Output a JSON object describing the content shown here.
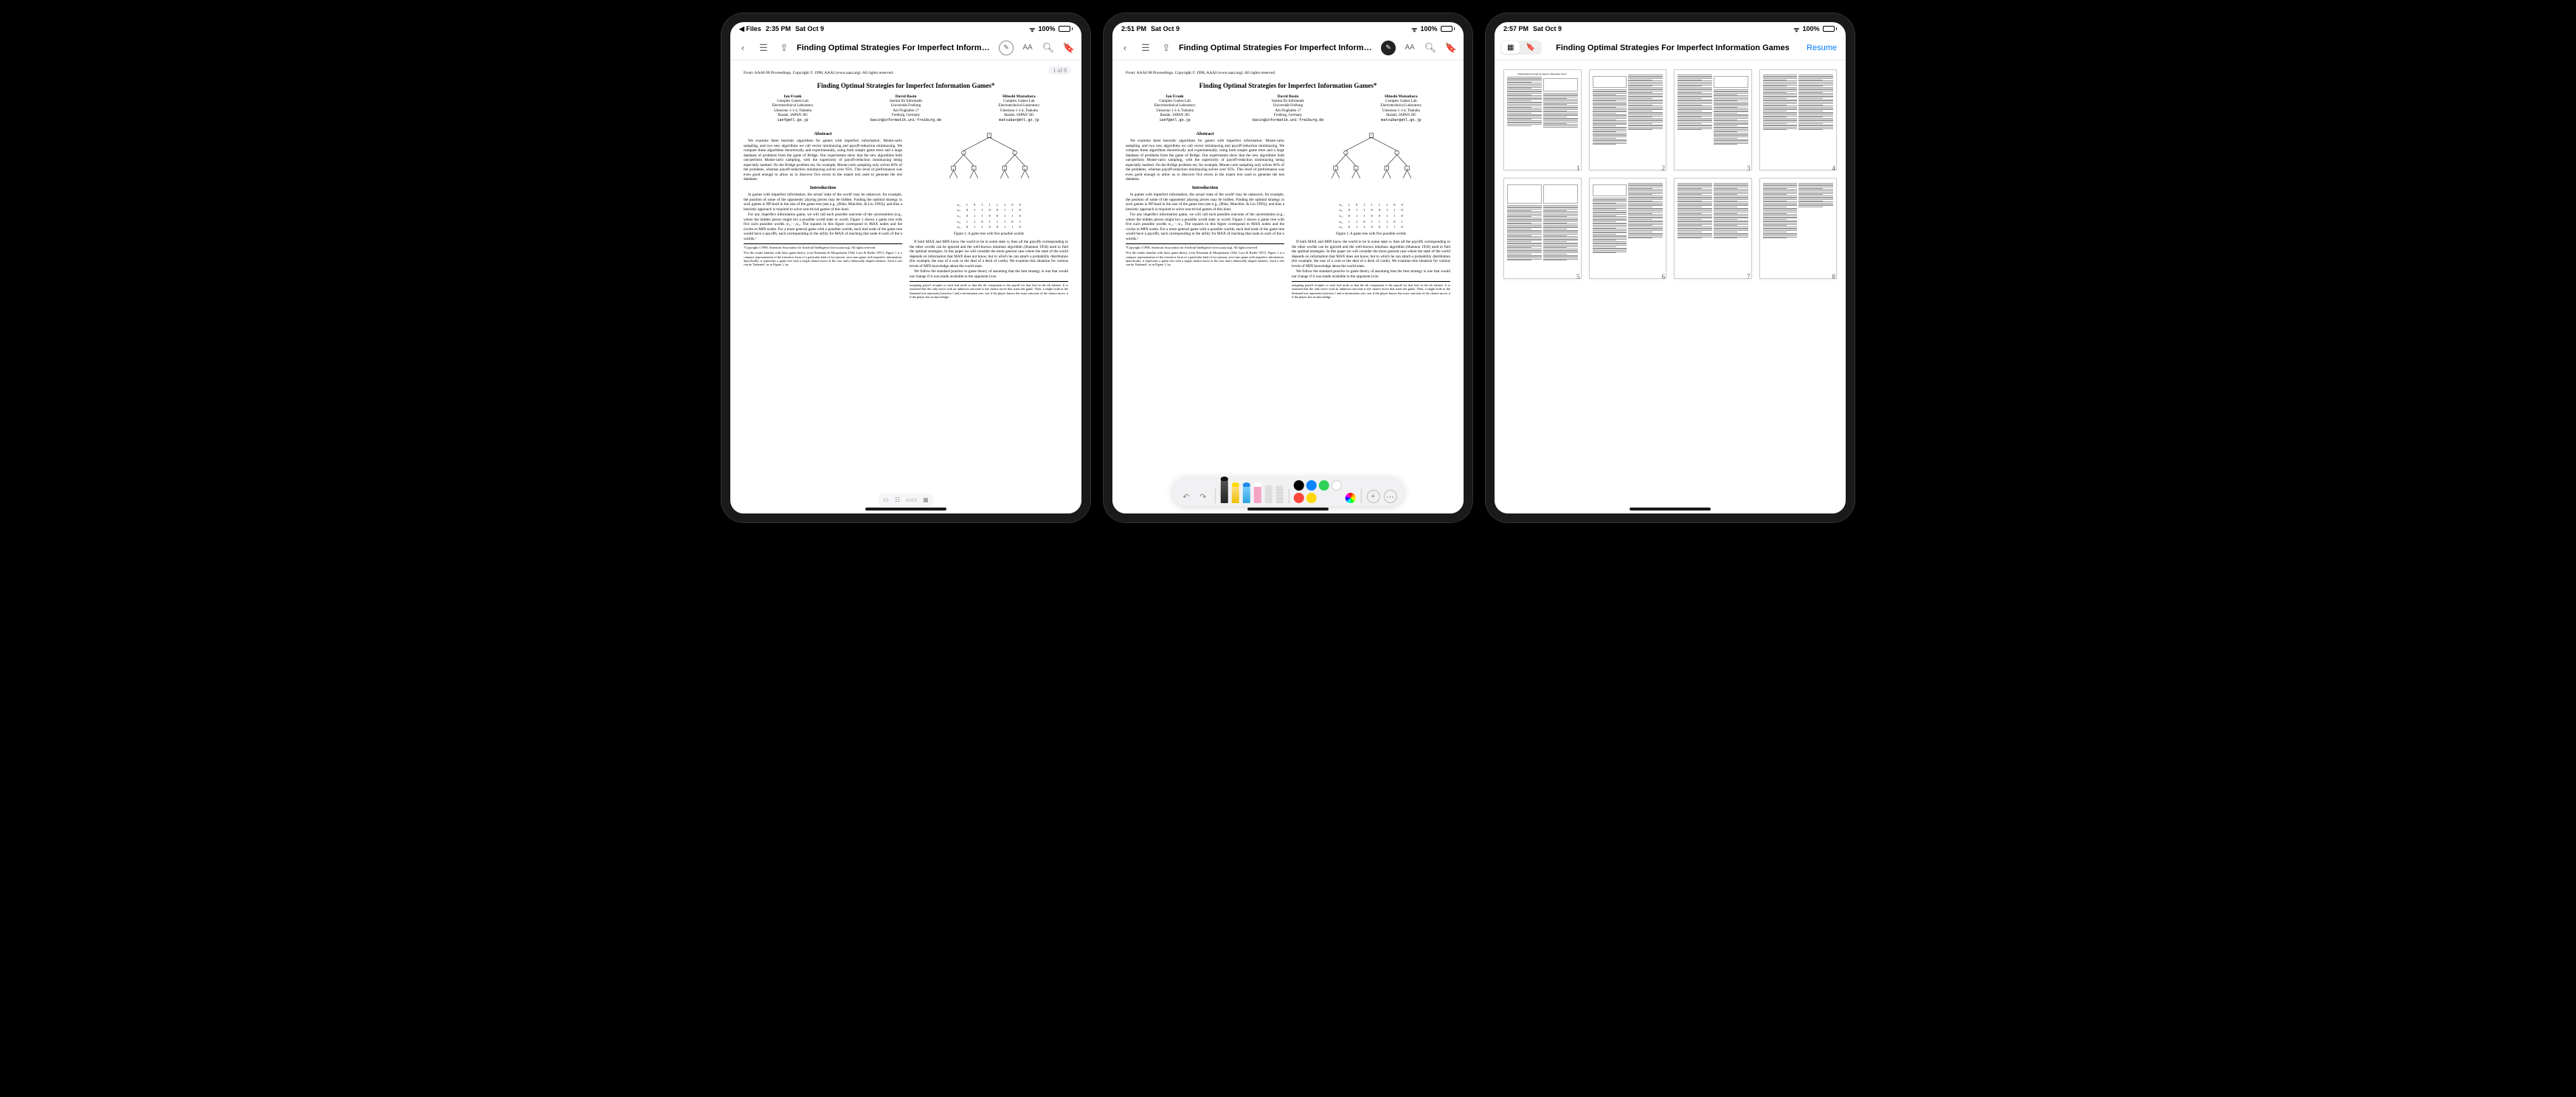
{
  "status": {
    "back_app": "Files",
    "time1": "2:35 PM",
    "time2": "2:51 PM",
    "time3": "2:57 PM",
    "date": "Sat Oct 9",
    "battery": "100%"
  },
  "document": {
    "title": "Finding Optimal Strategies For Imperfect Information Games",
    "page_indicator": "1 of 8",
    "total_pages": 8,
    "resume_label": "Resume"
  },
  "paper": {
    "source_line": "From: AAAI-98 Proceedings. Copyright © 1998, AAAI (www.aaai.org). All rights reserved.",
    "title": "Finding Optimal Strategies for Imperfect Information Games*",
    "authors": [
      {
        "name": "Ian Frank",
        "affil": "Complex Games Lab\nElectrotechnical Laboratory\nUmezono 1-1-4, Tsukuba\nIbaraki, JAPAN 305",
        "email": "ianf@etl.go.jp"
      },
      {
        "name": "David Basin",
        "affil": "Institut für Informatik\nUniversität Freiburg\nAm Flughafen 17\nFreiburg, Germany",
        "email": "basin@informatik.uni-freiburg.de"
      },
      {
        "name": "Hitoshi Matsubara",
        "affil": "Complex Games Lab\nElectrotechnical Laboratory\nUmezono 1-1-4, Tsukuba\nIbaraki, JAPAN 305",
        "email": "matsubar@etl.go.jp"
      }
    ],
    "abstract_head": "Abstract",
    "abstract": "We examine three heuristic algorithms for games with imperfect information: Monte-carlo sampling, and two new algorithms we call vector minimaxing and payoff-reduction minimaxing. We compare these algorithms theoretically and experimentally, using both simple game trees and a large database of problems from the game of Bridge. Our experiments show that the new algorithms both out-perform Monte-carlo sampling, with the superiority of payoff-reduction minimaxing being especially marked. On the Bridge problem set, for example, Monte-carlo sampling only solves 66% of the problems, whereas payoff-reduction minimaxing solves over 95%. This level of performance was even good enough to allow us to discover five errors in the expert text used to generate the test database.",
    "intro_head": "Introduction",
    "intro_p1": "In games with imperfect information, the actual 'state of the world' may be unknown; for example, the position of some of the opponents' playing pieces may be hidden. Finding the optimal strategy in such games is NP-hard in the size of the game tree (see e.g., (Blair, Mutchler, & Liu 1993)), and thus a heuristic approach is required to solve non-trivial games of this kind.",
    "intro_p2": "For any imperfect information game, we will call each possible outcome of the uncertainties (e.g., where the hidden pieces might be) a possible world state or world. Figure 1 shows a game tree with five such possible worlds w₁,···,w₅. The squares in this figure correspond to MAX nodes and the circles to MIN nodes. For a more general game with n possible worlds, each leaf node of the game tree would have n payoffs, each corresponding to the utility for MAX of reaching that node in each of the n worlds.¹",
    "fig1_caption": "Figure 1: A game tree with five possible worlds",
    "col2_p1": "If both MAX and MIN know the world to be in some state wᵢ then all the payoffs corresponding to the other worlds can be ignored and the well-known minimax algorithm (Shannon 1950) used to find the optimal strategies. In this paper we will consider the more general case where the state of the world depends on information that MAX does not know, but to which he can attach a probability distribution (for example, the toss of a coin or the deal of a deck of cards). We examine this situation for various levels of MIN knowledge about the world state.",
    "col2_p2": "We follow the standard practice in game theory of assuming that the best strategy is one that would not change if it was made available to the opponent (von",
    "fn_copyright": "*Copyright ©1998, American Association for Artificial Intelligence (www.aaai.org). All rights reserved.",
    "fn_reader": "¹For the reader familiar with basic game-theory, (von Neumann & Morgenstern 1944; Luce & Raiffa 1957), Figure 1 is a compact representation of the extensive form of a particular kind of two-person, zero-sum game with imperfect information. Specifically, it represents a game tree with a single chance-move at the root and n identically shaped subtrees. Such a tree can be 'flattened', as in Figure 1, by",
    "col2_fn": "assigning payoff n-tuples to each leaf node so that the ith component is the payoff for that leaf in the ith subtree. It is assumed that the only move with an unknown outcome is the chance move that starts the game. Then, a single node in the flattened tree represents between 1 and n information sets: one if the player knows the exact outcome of the chance move, n if the player has no knowledge.",
    "payoff_table": [
      [
        "w₁",
        "1",
        "0",
        "1",
        "1",
        "1",
        "1",
        "0",
        "0"
      ],
      [
        "w₂",
        "0",
        "1",
        "1",
        "0",
        "0",
        "1",
        "1",
        "0"
      ],
      [
        "w₃",
        "0",
        "1",
        "1",
        "0",
        "0",
        "1",
        "1",
        "0"
      ],
      [
        "w₄",
        "1",
        "1",
        "0",
        "1",
        "1",
        "1",
        "0",
        "1"
      ],
      [
        "w₅",
        "0",
        "1",
        "1",
        "0",
        "0",
        "1",
        "1",
        "0"
      ]
    ]
  },
  "markup_tools": {
    "undo": "↶",
    "redo": "↷",
    "colors": [
      "#000000",
      "#0a84ff",
      "#30d158",
      "#ffffff",
      "#ff453a",
      "#ffd60a"
    ],
    "add": "+",
    "more": "⋯"
  },
  "thumbnails": {
    "pages": [
      1,
      2,
      3,
      4,
      5,
      6,
      7,
      8
    ]
  }
}
